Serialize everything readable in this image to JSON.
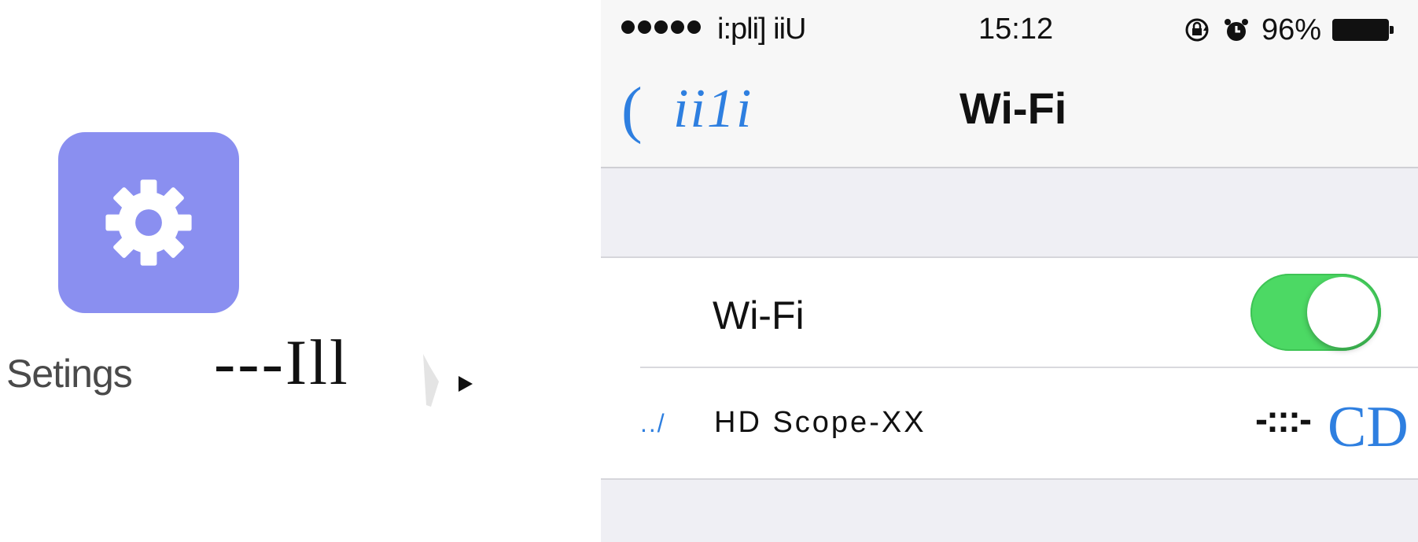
{
  "left_panel": {
    "app_icon": {
      "name": "gear-icon",
      "color": "#8a8ff0"
    },
    "app_label": "Setings",
    "arrow_text": "---Ill"
  },
  "status_bar": {
    "carrier": "i:pli] iiU",
    "time": "15:12",
    "battery_percent": "96%",
    "icons": [
      "rotation-lock-icon",
      "alarm-icon",
      "battery-icon"
    ]
  },
  "nav_bar": {
    "back_chevron": "(",
    "back_label": "ii1i",
    "title": "Wi-Fi",
    "accent_color": "#2e7fe0"
  },
  "wifi_row": {
    "label": "Wi-Fi",
    "toggle_on": true,
    "toggle_color": "#4cd964"
  },
  "network_row": {
    "check_mark": "../",
    "name": "HD Scope-XX",
    "lock_wifi_glyph": "-:::-",
    "info_glyph": "CD"
  }
}
